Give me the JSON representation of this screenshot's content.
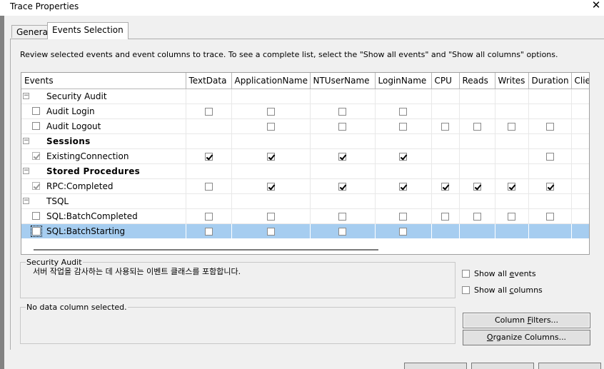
{
  "window": {
    "title": "Trace Properties"
  },
  "tabs": {
    "general": "General",
    "events_selection": "Events Selection"
  },
  "instruction": "Review selected events and event columns to trace. To see a complete list, select the \"Show all events\" and \"Show all columns\" options.",
  "grid": {
    "columns": [
      "Events",
      "TextData",
      "ApplicationName",
      "NTUserName",
      "LoginName",
      "CPU",
      "Reads",
      "Writes",
      "Duration",
      "Clie"
    ],
    "rows": [
      {
        "type": "category",
        "label": "Security Audit",
        "bold": false
      },
      {
        "type": "event",
        "label": "Audit Login",
        "checked": false,
        "cells": [
          "off",
          "off",
          "off",
          "off",
          "",
          "",
          "",
          "",
          ""
        ]
      },
      {
        "type": "event",
        "label": "Audit Logout",
        "checked": false,
        "cells": [
          "",
          "off",
          "off",
          "off",
          "off",
          "off",
          "off",
          "off",
          ""
        ]
      },
      {
        "type": "category",
        "label": "Sessions",
        "bold": true
      },
      {
        "type": "event",
        "label": "ExistingConnection",
        "checked": true,
        "cells": [
          "on",
          "on",
          "on",
          "on",
          "",
          "",
          "",
          "off",
          ""
        ]
      },
      {
        "type": "category",
        "label": "Stored Procedures",
        "bold": true
      },
      {
        "type": "event",
        "label": "RPC:Completed",
        "checked": true,
        "cells": [
          "off",
          "on",
          "on",
          "on",
          "on",
          "on",
          "on",
          "on",
          ""
        ]
      },
      {
        "type": "category",
        "label": "TSQL",
        "bold": false
      },
      {
        "type": "event",
        "label": "SQL:BatchCompleted",
        "checked": false,
        "cells": [
          "off",
          "off",
          "off",
          "off",
          "off",
          "off",
          "off",
          "off",
          ""
        ]
      },
      {
        "type": "event",
        "label": "SQL:BatchStarting",
        "checked": false,
        "selected": true,
        "cells": [
          "off",
          "off",
          "off",
          "off",
          "",
          "",
          "",
          "",
          ""
        ]
      }
    ]
  },
  "description": {
    "title": "Security Audit",
    "text": "서버 작업을 감사하는 데 사용되는 이벤트 클래스를 포함합니다."
  },
  "column_info": {
    "title": "No data column selected."
  },
  "options": {
    "show_all_events": {
      "pre": "Show all ",
      "accel": "e",
      "post": "vents",
      "checked": false
    },
    "show_all_columns": {
      "pre": "Show all ",
      "accel": "c",
      "post": "olumns",
      "checked": false
    }
  },
  "buttons": {
    "column_filters": {
      "pre": "Column ",
      "accel": "F",
      "post": "ilters..."
    },
    "organize_columns": {
      "pre": "",
      "accel": "O",
      "post": "rganize Columns..."
    }
  }
}
